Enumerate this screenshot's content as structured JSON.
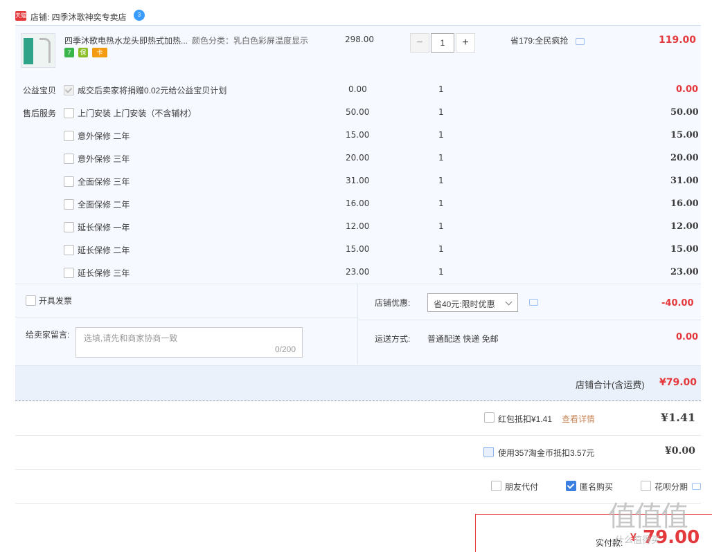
{
  "shop": {
    "logo_text": "天猫",
    "label": "店铺: 四季沐歌神奕专卖店",
    "ww_badge": "3"
  },
  "product": {
    "title": "四季沐歌电热水龙头即热式加热...",
    "attr": "颜色分类：乳白色彩屏温度显示",
    "price": "298.00",
    "quantity": "1",
    "minus": "−",
    "plus": "+",
    "promo": "省179:全民疯抢",
    "subtotal": "119.00",
    "badges": [
      "7",
      "保",
      "卡"
    ]
  },
  "services": {
    "charity_label": "公益宝贝",
    "charity_name": "成交后卖家将捐赠0.02元给公益宝贝计划",
    "charity_price": "0.00",
    "charity_qty": "1",
    "charity_total": "0.00",
    "after_label": "售后服务",
    "items": [
      {
        "name": "上门安装 上门安装（不含辅材）",
        "price": "50.00",
        "qty": "1",
        "total": "50.00"
      },
      {
        "name": "意外保修 二年",
        "price": "15.00",
        "qty": "1",
        "total": "15.00"
      },
      {
        "name": "意外保修 三年",
        "price": "20.00",
        "qty": "1",
        "total": "20.00"
      },
      {
        "name": "全面保修 三年",
        "price": "31.00",
        "qty": "1",
        "total": "31.00"
      },
      {
        "name": "全面保修 二年",
        "price": "16.00",
        "qty": "1",
        "total": "16.00"
      },
      {
        "name": "延长保修 一年",
        "price": "12.00",
        "qty": "1",
        "total": "12.00"
      },
      {
        "name": "延长保修 二年",
        "price": "15.00",
        "qty": "1",
        "total": "15.00"
      },
      {
        "name": "延长保修 三年",
        "price": "23.00",
        "qty": "1",
        "total": "23.00"
      }
    ]
  },
  "order": {
    "invoice_label": "开具发票",
    "memo_label": "给卖家留言:",
    "memo_placeholder": "选填,请先和商家协商一致",
    "memo_count": "0/200",
    "discount_label": "店铺优惠:",
    "discount_value": "省40元:限时优惠",
    "discount_amount": "-40.00",
    "shipping_label": "运送方式:",
    "shipping_value": "普通配送 快递 免邮",
    "shipping_amount": "0.00",
    "shop_total_label": "店铺合计(含运费)",
    "shop_total": "¥79.00"
  },
  "extras": {
    "redpacket_label": "红包抵扣¥1.41",
    "redpacket_link": "查看详情",
    "redpacket_amount": "¥1.41",
    "coins_label": "使用357淘金币抵扣3.57元",
    "coins_amount": "¥0.00",
    "friend_pay": "朋友代付",
    "anonymous": "匿名购买",
    "huabei": "花呗分期"
  },
  "payment": {
    "label": "实付款:",
    "amount": "79.00",
    "currency": "¥"
  },
  "watermark": {
    "text": "值值值",
    "site": "什么值得买"
  },
  "colors": {
    "accent_red": "#e4393c",
    "panel_bg": "#f6f9ff",
    "checkbox_blue": "#3b7fe0"
  }
}
